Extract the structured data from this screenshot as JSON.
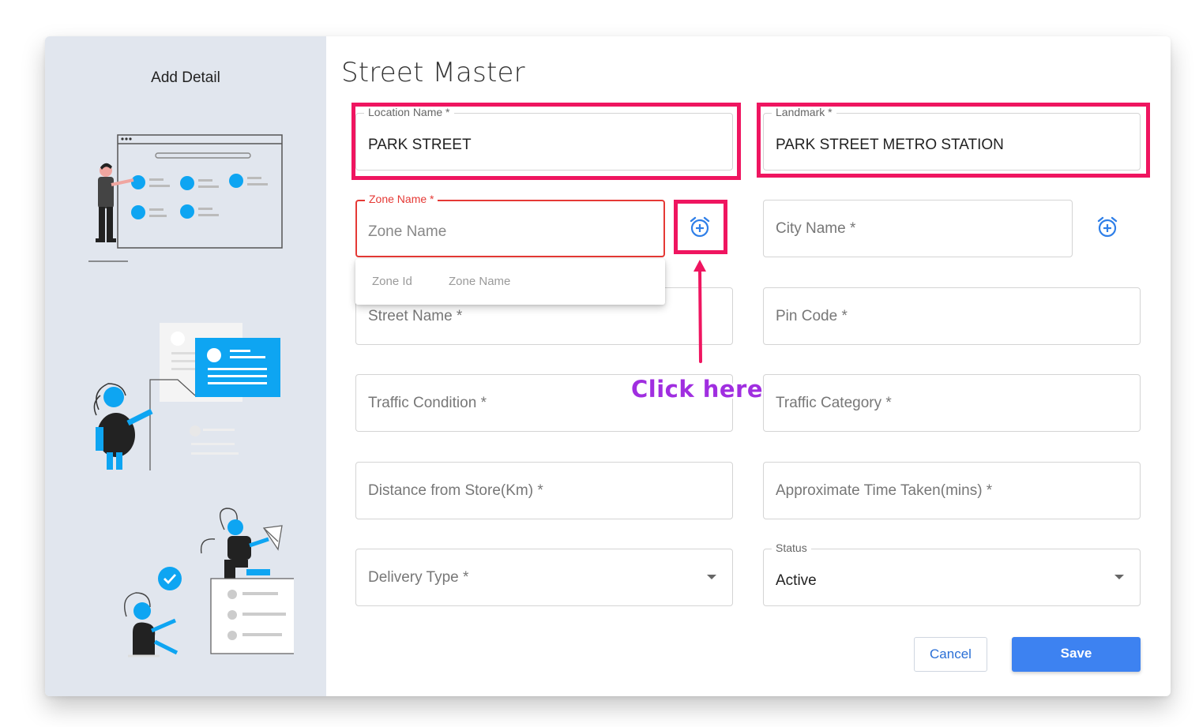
{
  "sidebar": {
    "title": "Add Detail"
  },
  "page": {
    "title": "Street Master"
  },
  "fields": {
    "location_name": {
      "label": "Location Name *",
      "value": "PARK STREET"
    },
    "landmark": {
      "label": "Landmark *",
      "value": "PARK STREET METRO STATION"
    },
    "zone_name": {
      "label": "Zone Name *",
      "placeholder": "Zone Name"
    },
    "city_name": {
      "placeholder": "City Name *"
    },
    "street_name": {
      "placeholder": "Street Name *"
    },
    "pin_code": {
      "placeholder": "Pin Code *"
    },
    "traffic_condition": {
      "placeholder": "Traffic Condition *"
    },
    "traffic_category": {
      "placeholder": "Traffic Category *"
    },
    "distance": {
      "placeholder": "Distance from Store(Km) *"
    },
    "approx_time": {
      "placeholder": "Approximate Time Taken(mins) *"
    },
    "delivery_type": {
      "placeholder": "Delivery Type *"
    },
    "status": {
      "label": "Status",
      "value": "Active"
    }
  },
  "zone_dropdown": {
    "columns": [
      "Zone Id",
      "Zone Name"
    ]
  },
  "annotation": {
    "text": "Click here"
  },
  "buttons": {
    "cancel": "Cancel",
    "save": "Save"
  },
  "colors": {
    "accent": "#3d82f1",
    "highlight": "#ef1560",
    "error": "#e53935",
    "annotation": "#a02ee0",
    "illustration": "#0ea5f2"
  },
  "icons": {
    "add_zone": "alarm-add-icon",
    "add_city": "alarm-add-icon",
    "dropdown": "caret-down-icon"
  }
}
